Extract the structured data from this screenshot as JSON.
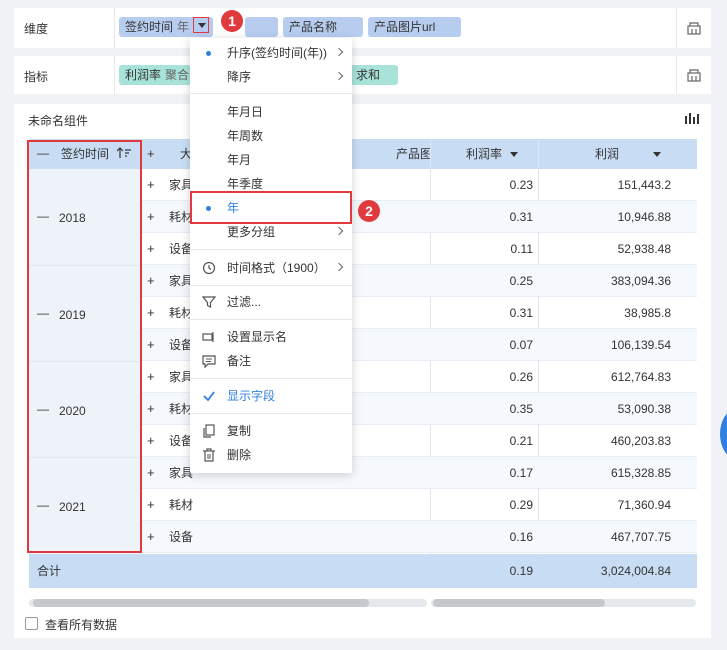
{
  "dimension": {
    "label": "维度",
    "fields": [
      {
        "name": "签约时间",
        "sub": "年"
      },
      {
        "name": ""
      },
      {
        "name": "产品名称"
      },
      {
        "name": "产品图片url"
      }
    ]
  },
  "metric": {
    "label": "指标",
    "fields": [
      {
        "name": "利润率",
        "sub": "聚合"
      },
      {
        "name": "求和"
      }
    ]
  },
  "component": {
    "title": "未命名组件"
  },
  "table": {
    "headers": {
      "sign_time": "签约时间",
      "category": "大",
      "product_image": "产品图",
      "profit_rate": "利润率",
      "profit": "利润"
    },
    "groups": [
      {
        "year": "2018",
        "rows": [
          {
            "category": "家具",
            "rate": "0.23",
            "profit": "151,443.2"
          },
          {
            "category": "耗材",
            "rate": "0.31",
            "profit": "10,946.88"
          },
          {
            "category": "设备",
            "rate": "0.11",
            "profit": "52,938.48"
          }
        ]
      },
      {
        "year": "2019",
        "rows": [
          {
            "category": "家具",
            "rate": "0.25",
            "profit": "383,094.36"
          },
          {
            "category": "耗材",
            "rate": "0.31",
            "profit": "38,985.8"
          },
          {
            "category": "设备",
            "rate": "0.07",
            "profit": "106,139.54"
          }
        ]
      },
      {
        "year": "2020",
        "rows": [
          {
            "category": "家具",
            "rate": "0.26",
            "profit": "612,764.83"
          },
          {
            "category": "耗材",
            "rate": "0.35",
            "profit": "53,090.38"
          },
          {
            "category": "设备",
            "rate": "0.21",
            "profit": "460,203.83"
          }
        ]
      },
      {
        "year": "2021",
        "rows": [
          {
            "category": "家具",
            "rate": "0.17",
            "profit": "615,328.85"
          },
          {
            "category": "耗材",
            "rate": "0.29",
            "profit": "71,360.94"
          },
          {
            "category": "设备",
            "rate": "0.16",
            "profit": "467,707.75"
          }
        ]
      }
    ],
    "total": {
      "label": "合计",
      "rate": "0.19",
      "profit": "3,024,004.84"
    }
  },
  "menu": {
    "items": {
      "asc": "升序(签约时间(年))",
      "desc": "降序",
      "ymd": "年月日",
      "yweek": "年周数",
      "ym": "年月",
      "yq": "年季度",
      "y": "年",
      "more_group": "更多分组",
      "time_format": "时间格式（1900）",
      "filter": "过滤...",
      "set_display_name": "设置显示名",
      "note": "备注",
      "show_field": "显示字段",
      "copy": "复制",
      "delete": "删除"
    }
  },
  "badges": {
    "one": "1",
    "two": "2"
  },
  "footer": {
    "view_all": "查看所有数据"
  },
  "colors": {
    "accent": "#2f7fe0",
    "highlight": "#e0393e",
    "header_bg": "#c8ddf4"
  }
}
